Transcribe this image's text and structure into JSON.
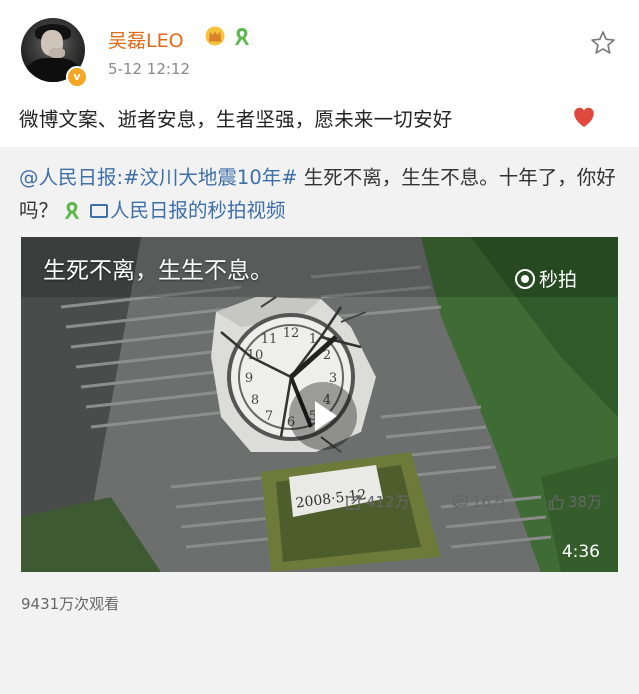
{
  "user": {
    "name": "吴磊LEO",
    "time": "5-12 12:12",
    "verified_badge": "v"
  },
  "post": {
    "text": "微博文案、逝者安息，生者坚强，愿未来一切安好"
  },
  "repost": {
    "author_link": "@人民日报",
    "colon": ":",
    "hashtag": "#汶川大地震10年#",
    "text": " 生死不离，生生不息。十年了，你好吗？",
    "video_link": "人民日报的秒拍视频"
  },
  "video": {
    "overlay_text": "生死不离，生生不息。",
    "watermark": "秒拍",
    "duration": "4:36",
    "stone_date": "2008·5·12",
    "clock_numbers": [
      "12",
      "1",
      "2",
      "3",
      "4",
      "5",
      "6",
      "7",
      "8",
      "9",
      "10",
      "11"
    ]
  },
  "stats": {
    "views": "9431万次观看",
    "repost_count": "412万",
    "comment_count": "16万",
    "like_count": "38万"
  },
  "colors": {
    "username": "#e36a16",
    "link": "#3d6fa8",
    "heart": "#e0493e",
    "ribbon": "#5cb84a"
  }
}
